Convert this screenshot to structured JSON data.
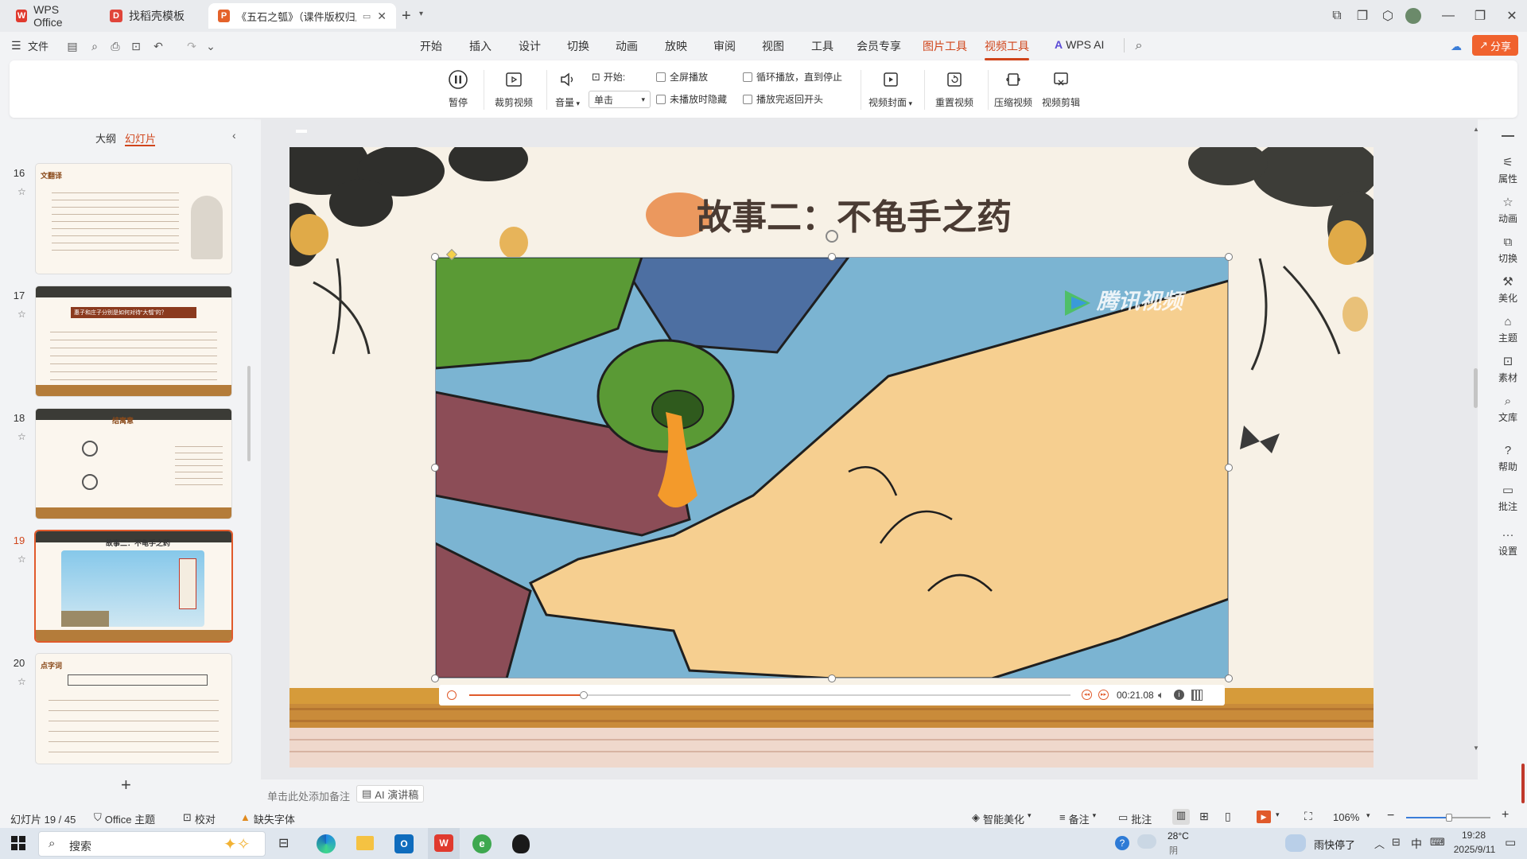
{
  "titlebar": {
    "tabs": [
      {
        "label": "WPS Office",
        "icon": "wps-logo",
        "color": "#e03a2e"
      },
      {
        "label": "找稻壳模板",
        "icon": "docer-logo",
        "color": "#e0453a"
      },
      {
        "label": "《五石之瓠》（课件版权归屬",
        "icon": "ppt-icon",
        "color": "#e4622a"
      }
    ],
    "new_tab": "+"
  },
  "menubar": {
    "file_label": "文件",
    "items": [
      "开始",
      "插入",
      "设计",
      "切换",
      "动画",
      "放映",
      "审阅",
      "视图",
      "工具",
      "会员专享",
      "图片工具",
      "视频工具"
    ],
    "ai_label": "WPS AI",
    "share_label": "分享"
  },
  "ribbon": {
    "pause_label": "暂停",
    "trim_label": "裁剪视频",
    "volume_label": "音量",
    "start_label": "开始:",
    "start_value": "单击",
    "fullscreen_label": "全屏播放",
    "hide_label": "未播放时隐藏",
    "loop_label": "循环播放，直到停止",
    "rewind_label": "播放完返回开头",
    "cover_label": "视频封面",
    "reset_label": "重置视频",
    "compress_label": "压缩视频",
    "edit_label": "视频剪辑"
  },
  "leftpanel": {
    "outline_tab": "大纲",
    "slides_tab": "幻灯片",
    "add_label": "+",
    "slides": [
      {
        "num": "16",
        "heading": "文翻译"
      },
      {
        "num": "17",
        "heading": "惠子和庄子分别是如何对待“大瓠”的？"
      },
      {
        "num": "18",
        "heading": "结寓意"
      },
      {
        "num": "19",
        "heading": "故事二：不龟手之药"
      },
      {
        "num": "20",
        "heading": "点字词"
      }
    ]
  },
  "slide": {
    "title": "故事二：不龟手之药",
    "watermark": "腾讯视频",
    "time": "00:21.08",
    "progress": 0.19
  },
  "rightbar": {
    "items": [
      "属性",
      "动画",
      "切换",
      "美化",
      "主题",
      "素材",
      "文库",
      "帮助",
      "批注",
      "设置"
    ]
  },
  "notes": {
    "placeholder": "单击此处添加备注",
    "ai_label": "AI 演讲稿"
  },
  "status": {
    "slide_info": "幻灯片 19 / 45",
    "theme": "Office 主题",
    "proof": "校对",
    "font_missing": "缺失字体",
    "beautify": "智能美化",
    "notes": "备注",
    "comments": "批注",
    "zoom": "106%"
  },
  "taskbar": {
    "search": "搜索",
    "weather_temp": "28°C",
    "weather_desc": "阴",
    "notify": "雨快停了",
    "ime": "中",
    "time": "19:28",
    "date": "2025/9/11"
  },
  "colors": {
    "accent": "#d0451b",
    "share_bg": "#f0622e"
  }
}
